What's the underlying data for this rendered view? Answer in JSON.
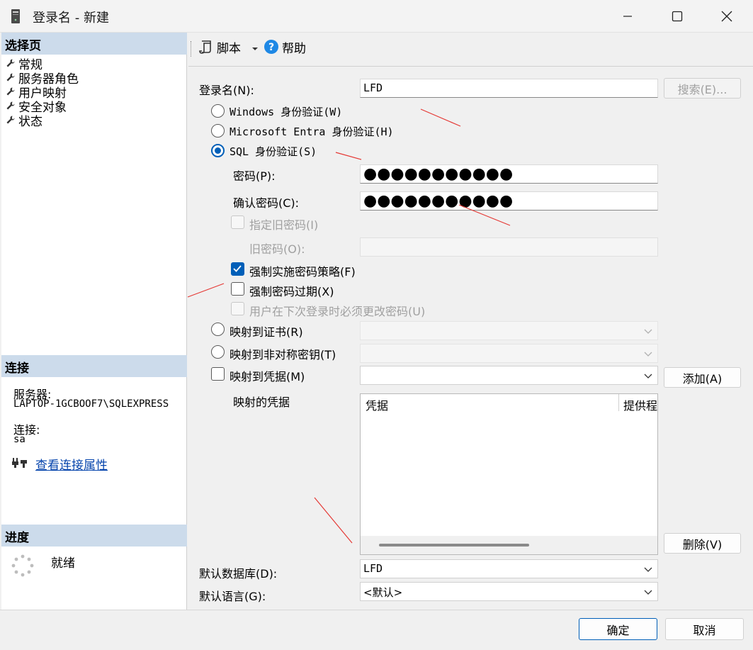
{
  "window": {
    "title": "登录名 - 新建"
  },
  "left": {
    "select_page_header": "选择页",
    "nav_items": [
      "常规",
      "服务器角色",
      "用户映射",
      "安全对象",
      "状态"
    ],
    "connection_header": "连接",
    "server_label": "服务器:",
    "server_value": "LAPTOP-1GCBOOF7\\SQLEXPRESS",
    "connection_label": "连接:",
    "connection_value": "sa",
    "view_connection_link": "查看连接属性",
    "progress_header": "进度",
    "progress_status": "就绪"
  },
  "toolbar": {
    "script_label": "脚本",
    "help_label": "帮助"
  },
  "form": {
    "login_name_label": "登录名(N):",
    "login_name_value": "LFD",
    "search_button": "搜索(E)...",
    "windows_auth": "Windows 身份验证(W)",
    "entra_auth": "Microsoft Entra 身份验证(H)",
    "sql_auth": "SQL 身份验证(S)",
    "selected_auth": "sql",
    "password_label": "密码(P):",
    "password_mask": "●●●●●●●●●●●",
    "confirm_label": "确认密码(C):",
    "confirm_mask": "●●●●●●●●●●●",
    "specify_old_label": "指定旧密码(I)",
    "old_password_label": "旧密码(O):",
    "enforce_policy_label": "强制实施密码策略(F)",
    "enforce_policy_checked": true,
    "enforce_expiration_label": "强制密码过期(X)",
    "enforce_expiration_checked": false,
    "must_change_label": "用户在下次登录时必须更改密码(U)",
    "map_cert_label": "映射到证书(R)",
    "map_asym_label": "映射到非对称密钥(T)",
    "map_credential_label": "映射到凭据(M)",
    "add_button": "添加(A)",
    "mapped_credentials_label": "映射的凭据",
    "grid_col_credential": "凭据",
    "grid_col_provider": "提供程",
    "remove_button": "删除(V)",
    "default_db_label": "默认数据库(D):",
    "default_db_value": "LFD",
    "default_lang_label": "默认语言(G):",
    "default_lang_value": "<默认>"
  },
  "footer": {
    "ok_button": "确定",
    "cancel_button": "取消"
  },
  "colors": {
    "accent": "#005fb8",
    "section_header": "#ccdbeb",
    "link": "#0645ad",
    "annotation_arrow": "#e53935"
  }
}
